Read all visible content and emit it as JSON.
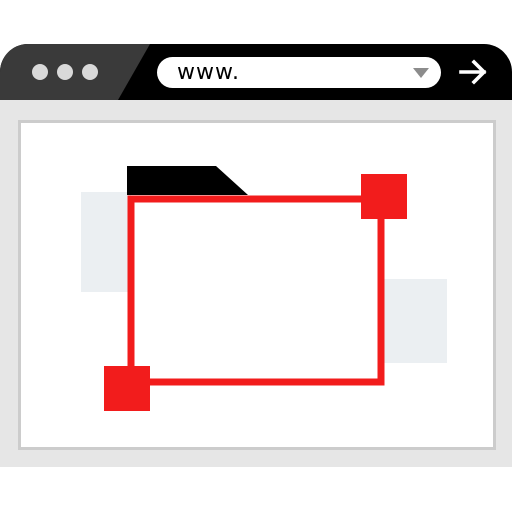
{
  "window": {
    "controls": [
      "window-dot",
      "window-dot",
      "window-dot"
    ]
  },
  "address_bar": {
    "url_text": "www.",
    "dropdown_icon": "triangle-down",
    "go_icon": "arrow-right"
  },
  "content": {
    "illustration": "folder-selection-icon"
  },
  "colors": {
    "titlebar": "#000000",
    "titlebar_left": "#3a3a3a",
    "window_dots": "#d9d9d9",
    "content_bg": "#e6e6e6",
    "accent_red": "#f21c1c",
    "shadow_blocks": "#ebeff2"
  }
}
